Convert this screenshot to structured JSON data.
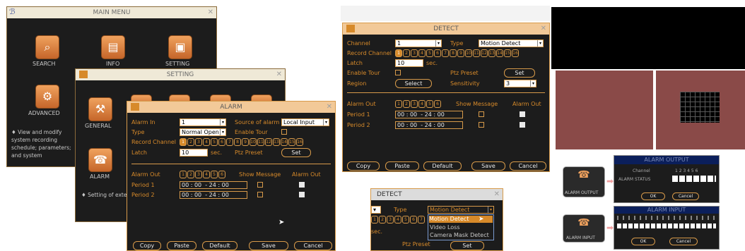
{
  "main_menu": {
    "title": "MAIN MENU",
    "items": [
      "SEARCH",
      "INFO",
      "SETTING",
      "ADVANCED"
    ],
    "hint": "View and modify system recording schedule; parameters; and system"
  },
  "setting": {
    "title": "SETTING",
    "items": [
      "GENERAL",
      "ALARM"
    ],
    "hint": "Setting of external alarm"
  },
  "alarm": {
    "title": "ALARM",
    "alarm_in_label": "Alarm In",
    "alarm_in_value": "1",
    "source_label": "Source of alarm",
    "source_value": "Local Input",
    "type_label": "Type",
    "type_value": "Normal Open",
    "enable_tour_label": "Enable Tour",
    "record_channel_label": "Record Channel",
    "latch_label": "Latch",
    "latch_value": "10",
    "latch_unit": "sec.",
    "ptz_label": "Ptz Preset",
    "set_label": "Set",
    "alarm_out_label": "Alarm Out",
    "show_msg_label": "Show Message",
    "alarm_out_col": "Alarm Out",
    "period1_label": "Period 1",
    "period2_label": "Period 2",
    "period_start": "00 : 00",
    "period_end": "- 24 : 00",
    "buttons": [
      "Copy",
      "Paste",
      "Default",
      "Save",
      "Cancel"
    ]
  },
  "detect": {
    "title": "DETECT",
    "channel_label": "Channel",
    "channel_value": "1",
    "type_label": "Type",
    "type_value": "Motion Detect",
    "record_channel_label": "Record Channel",
    "latch_label": "Latch",
    "latch_value": "10",
    "latch_unit": "sec.",
    "enable_tour_label": "Enable Tour",
    "ptz_label": "Ptz Preset",
    "set_label": "Set",
    "region_label": "Region",
    "select_label": "Select",
    "sensitivity_label": "Sensitivity",
    "sensitivity_value": "3",
    "alarm_out_label": "Alarm Out",
    "show_msg_label": "Show Message",
    "alarm_out_col": "Alarm Out",
    "period1_label": "Period 1",
    "period2_label": "Period 2",
    "period_start": "00 : 00",
    "period_end": "- 24 : 00",
    "buttons": [
      "Copy",
      "Paste",
      "Default",
      "Save",
      "Cancel"
    ]
  },
  "detect_dropdown": {
    "title": "DETECT",
    "type_label": "Type",
    "type_value": "Motion Detect",
    "options": [
      "Motion Detect",
      "Video Loss",
      "Camera Mask Detect"
    ],
    "sec": "sec.",
    "ptz_label": "Ptz Preset",
    "set_label": "Set"
  },
  "alarm_output": {
    "title": "ALARM OUTPUT",
    "channel_label": "Channel",
    "channel_nums": "1 2 3 4 5 6",
    "status_label": "ALARM STATUS",
    "icon_label": "ALARM OUTPUT",
    "ok": "OK",
    "cancel": "Cancel"
  },
  "alarm_input": {
    "title": "ALARM INPUT",
    "icon_label": "ALARM INPUT",
    "ok": "OK",
    "cancel": "Cancel"
  },
  "record_nums": [
    "1",
    "2",
    "3",
    "4",
    "5",
    "6",
    "7",
    "8",
    "9",
    "10",
    "11",
    "12",
    "13",
    "14",
    "15",
    "16"
  ],
  "out_nums": [
    "1",
    "2",
    "3",
    "4",
    "5",
    "6"
  ]
}
